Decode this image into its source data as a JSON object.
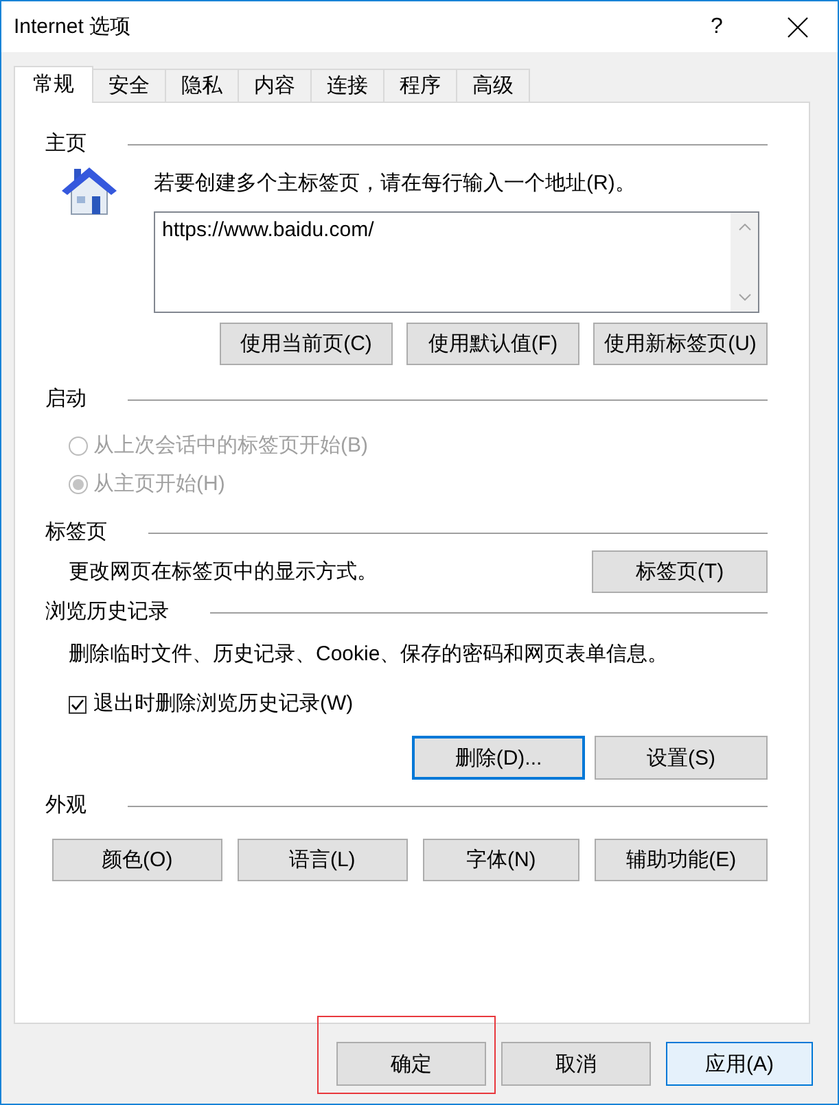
{
  "window": {
    "title": "Internet 选项",
    "help": "?"
  },
  "tabs": [
    {
      "label": "常规",
      "selected": true
    },
    {
      "label": "安全",
      "selected": false
    },
    {
      "label": "隐私",
      "selected": false
    },
    {
      "label": "内容",
      "selected": false
    },
    {
      "label": "连接",
      "selected": false
    },
    {
      "label": "程序",
      "selected": false
    },
    {
      "label": "高级",
      "selected": false
    }
  ],
  "home": {
    "heading": "主页",
    "instruction": "若要创建多个主标签页，请在每行输入一个地址(R)。",
    "addresses": "https://www.baidu.com/",
    "buttons": [
      "使用当前页(C)",
      "使用默认值(F)",
      "使用新标签页(U)"
    ]
  },
  "startup": {
    "heading": "启动",
    "options": [
      {
        "label": "从上次会话中的标签页开始(B)",
        "selected": false,
        "disabled": true
      },
      {
        "label": "从主页开始(H)",
        "selected": true,
        "disabled": true
      }
    ]
  },
  "tab_settings": {
    "heading": "标签页",
    "description": "更改网页在标签页中的显示方式。",
    "button": "标签页(T)"
  },
  "history": {
    "heading": "浏览历史记录",
    "description": "删除临时文件、历史记录、Cookie、保存的密码和网页表单信息。",
    "delete_on_exit": {
      "label": "退出时删除浏览历史记录(W)",
      "checked": true
    },
    "buttons": [
      {
        "label": "删除(D)...",
        "focused": true
      },
      {
        "label": "设置(S)",
        "focused": false
      }
    ]
  },
  "appearance": {
    "heading": "外观",
    "buttons": [
      "颜色(O)",
      "语言(L)",
      "字体(N)",
      "辅助功能(E)"
    ]
  },
  "dialog_buttons": [
    {
      "label": "确定",
      "highlighted": true,
      "hovered": false
    },
    {
      "label": "取消",
      "highlighted": false,
      "hovered": false
    },
    {
      "label": "应用(A)",
      "highlighted": false,
      "hovered": true
    }
  ]
}
